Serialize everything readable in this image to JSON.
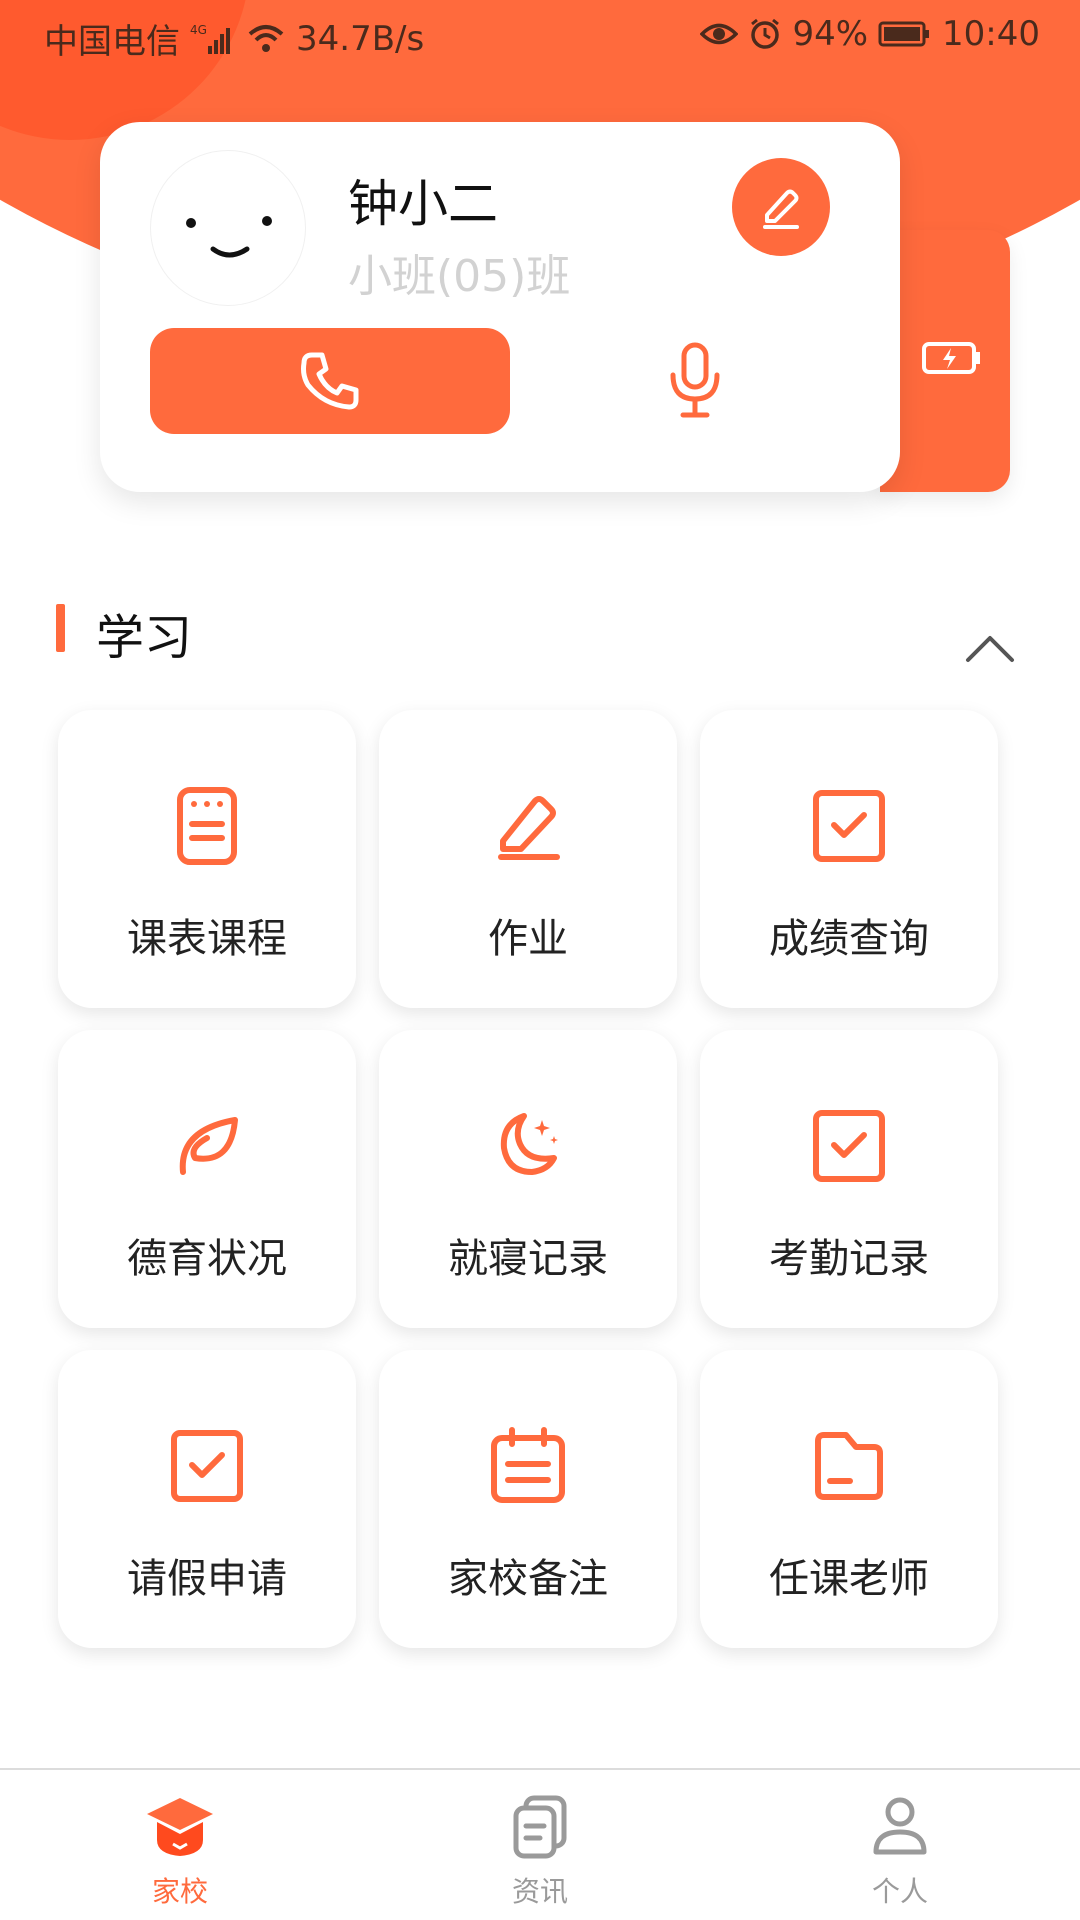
{
  "status_bar": {
    "carrier": "中国电信",
    "network": "4G",
    "speed": "34.7B/s",
    "battery": "94%",
    "time": "10:40",
    "icons": [
      "signal-icon",
      "wifi-icon",
      "eye-icon",
      "alarm-icon",
      "battery-icon"
    ]
  },
  "profile": {
    "name": "钟小二",
    "class_name": "小班(05)班",
    "icons": {
      "edit": "edit-pencil-icon",
      "call": "phone-icon",
      "voice": "microphone-icon",
      "device": "battery-charging-icon"
    }
  },
  "section": {
    "title": "学习",
    "collapse_icon": "chevron-up-icon"
  },
  "grid": [
    {
      "label": "课表课程",
      "icon": "schedule-icon"
    },
    {
      "label": "作业",
      "icon": "pencil-icon"
    },
    {
      "label": "成绩查询",
      "icon": "checkbox-icon"
    },
    {
      "label": "德育状况",
      "icon": "leaf-icon"
    },
    {
      "label": "就寝记录",
      "icon": "moon-icon"
    },
    {
      "label": "考勤记录",
      "icon": "checkbox-icon"
    },
    {
      "label": "请假申请",
      "icon": "checkbox-icon"
    },
    {
      "label": "家校备注",
      "icon": "calendar-icon"
    },
    {
      "label": "任课老师",
      "icon": "folder-icon"
    }
  ],
  "bottom_nav": [
    {
      "label": "家校",
      "icon": "graduation-cap-icon",
      "active": true
    },
    {
      "label": "资讯",
      "icon": "document-icon",
      "active": false
    },
    {
      "label": "个人",
      "icon": "person-icon",
      "active": false
    }
  ],
  "colors": {
    "accent": "#ff6a3d",
    "text": "#222222",
    "muted": "#9a9a9a",
    "subtle": "#d2d2d2"
  }
}
